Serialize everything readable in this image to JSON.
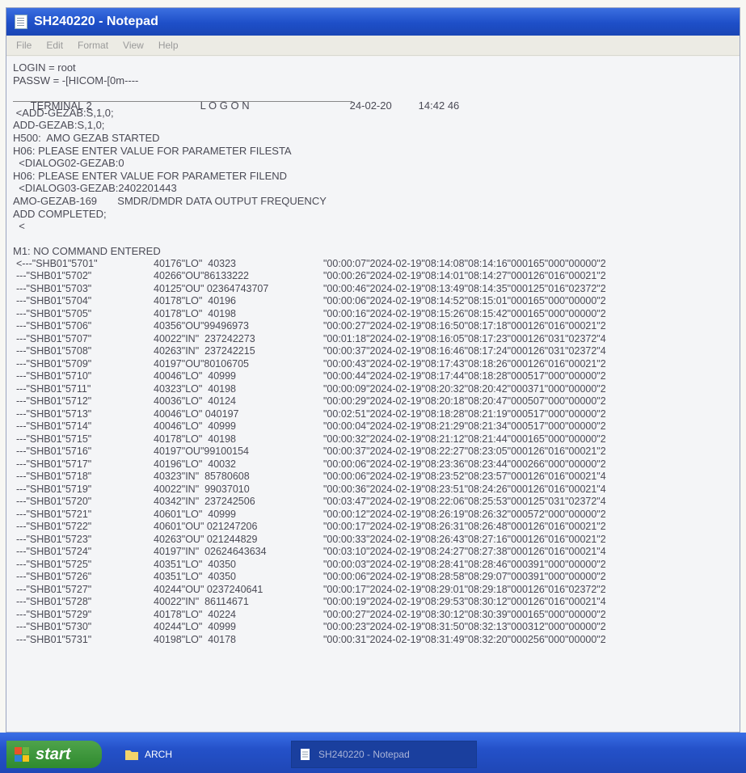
{
  "window": {
    "title": "SH240220 - Notepad"
  },
  "menu": [
    "File",
    "Edit",
    "Format",
    "View",
    "Help"
  ],
  "header": {
    "login": "LOGIN = root",
    "passw": "PASSW = -[HICOM-[0m----",
    "terminal": "TERMINAL 2",
    "logon": "L O G O N",
    "date": "24-02-20",
    "time": "14:42 46"
  },
  "log_lines": [
    " <ADD-GEZAB:S,1,0;",
    "ADD-GEZAB:S,1,0;",
    "H500:  AMO GEZAB STARTED",
    "H06: PLEASE ENTER VALUE FOR PARAMETER FILESTA",
    "  <DIALOG02-GEZAB:0",
    "H06: PLEASE ENTER VALUE FOR PARAMETER FILEND",
    "  <DIALOG03-GEZAB:2402201443",
    "AMO-GEZAB-169       SMDR/DMDR DATA OUTPUT FREQUENCY",
    "ADD COMPLETED;",
    "  <",
    "",
    "M1: NO COMMAND ENTERED"
  ],
  "records": [
    [
      "<---\"SHB01\"5701\"",
      "40176\"LO\"  40323",
      "\"00:00:07\"2024-02-19\"08:14:08\"08:14:16\"000165\"000\"00000\"2"
    ],
    [
      "---\"SHB01\"5702\"",
      "40266\"OU\"86133222",
      "\"00:00:26\"2024-02-19\"08:14:01\"08:14:27\"000126\"016\"00021\"2"
    ],
    [
      "---\"SHB01\"5703\"",
      "40125\"OU\" 02364743707",
      "\"00:00:46\"2024-02-19\"08:13:49\"08:14:35\"000125\"016\"02372\"2"
    ],
    [
      "---\"SHB01\"5704\"",
      "40178\"LO\"  40196",
      "\"00:00:06\"2024-02-19\"08:14:52\"08:15:01\"000165\"000\"00000\"2"
    ],
    [
      "---\"SHB01\"5705\"",
      "40178\"LO\"  40198",
      "\"00:00:16\"2024-02-19\"08:15:26\"08:15:42\"000165\"000\"00000\"2"
    ],
    [
      "---\"SHB01\"5706\"",
      "40356\"OU\"99496973",
      "\"00:00:27\"2024-02-19\"08:16:50\"08:17:18\"000126\"016\"00021\"2"
    ],
    [
      "---\"SHB01\"5707\"",
      "40022\"IN\"  237242273",
      "\"00:01:18\"2024-02-19\"08:16:05\"08:17:23\"000126\"031\"02372\"4"
    ],
    [
      "---\"SHB01\"5708\"",
      "40263\"IN\"  237242215",
      "\"00:00:37\"2024-02-19\"08:16:46\"08:17:24\"000126\"031\"02372\"4"
    ],
    [
      "---\"SHB01\"5709\"",
      "40197\"OU\"80106705",
      "\"00:00:43\"2024-02-19\"08:17:43\"08:18:26\"000126\"016\"00021\"2"
    ],
    [
      "---\"SHB01\"5710\"",
      "40046\"LO\"  40999",
      "\"00:00:44\"2024-02-19\"08:17:44\"08:18:28\"000517\"000\"00000\"2"
    ],
    [
      "---\"SHB01\"5711\"",
      "40323\"LO\"  40198",
      "\"00:00:09\"2024-02-19\"08:20:32\"08:20:42\"000371\"000\"00000\"2"
    ],
    [
      "---\"SHB01\"5712\"",
      "40036\"LO\"  40124",
      "\"00:00:29\"2024-02-19\"08:20:18\"08:20:47\"000507\"000\"00000\"2"
    ],
    [
      "---\"SHB01\"5713\"",
      "40046\"LO\" 040197",
      "\"00:02:51\"2024-02-19\"08:18:28\"08:21:19\"000517\"000\"00000\"2"
    ],
    [
      "---\"SHB01\"5714\"",
      "40046\"LO\"  40999",
      "\"00:00:04\"2024-02-19\"08:21:29\"08:21:34\"000517\"000\"00000\"2"
    ],
    [
      "---\"SHB01\"5715\"",
      "40178\"LO\"  40198",
      "\"00:00:32\"2024-02-19\"08:21:12\"08:21:44\"000165\"000\"00000\"2"
    ],
    [
      "---\"SHB01\"5716\"",
      "40197\"OU\"99100154",
      "\"00:00:37\"2024-02-19\"08:22:27\"08:23:05\"000126\"016\"00021\"2"
    ],
    [
      "---\"SHB01\"5717\"",
      "40196\"LO\"  40032",
      "\"00:00:06\"2024-02-19\"08:23:36\"08:23:44\"000266\"000\"00000\"2"
    ],
    [
      "---\"SHB01\"5718\"",
      "40323\"IN\"  85780608",
      "\"00:00:06\"2024-02-19\"08:23:52\"08:23:57\"000126\"016\"00021\"4"
    ],
    [
      "---\"SHB01\"5719\"",
      "40022\"IN\"  99037010",
      "\"00:00:36\"2024-02-19\"08:23:51\"08:24:26\"000126\"016\"00021\"4"
    ],
    [
      "---\"SHB01\"5720\"",
      "40342\"IN\"  237242506",
      "\"00:03:47\"2024-02-19\"08:22:06\"08:25:53\"000125\"031\"02372\"4"
    ],
    [
      "---\"SHB01\"5721\"",
      "40601\"LO\"  40999",
      "\"00:00:12\"2024-02-19\"08:26:19\"08:26:32\"000572\"000\"00000\"2"
    ],
    [
      "---\"SHB01\"5722\"",
      "40601\"OU\" 021247206",
      "\"00:00:17\"2024-02-19\"08:26:31\"08:26:48\"000126\"016\"00021\"2"
    ],
    [
      "---\"SHB01\"5723\"",
      "40263\"OU\" 021244829",
      "\"00:00:33\"2024-02-19\"08:26:43\"08:27:16\"000126\"016\"00021\"2"
    ],
    [
      "---\"SHB01\"5724\"",
      "40197\"IN\"  02624643634",
      "\"00:03:10\"2024-02-19\"08:24:27\"08:27:38\"000126\"016\"00021\"4"
    ],
    [
      "---\"SHB01\"5725\"",
      "40351\"LO\"  40350",
      "\"00:00:03\"2024-02-19\"08:28:41\"08:28:46\"000391\"000\"00000\"2"
    ],
    [
      "---\"SHB01\"5726\"",
      "40351\"LO\"  40350",
      "\"00:00:06\"2024-02-19\"08:28:58\"08:29:07\"000391\"000\"00000\"2"
    ],
    [
      "---\"SHB01\"5727\"",
      "40244\"OU\" 0237240641",
      "\"00:00:17\"2024-02-19\"08:29:01\"08:29:18\"000126\"016\"02372\"2"
    ],
    [
      "---\"SHB01\"5728\"",
      "40022\"IN\"  86114671",
      "\"00:00:19\"2024-02-19\"08:29:53\"08:30:12\"000126\"016\"00021\"4"
    ],
    [
      "---\"SHB01\"5729\"",
      "40178\"LO\"  40224",
      "\"00:00:27\"2024-02-19\"08:30:12\"08:30:39\"000165\"000\"00000\"2"
    ],
    [
      "---\"SHB01\"5730\"",
      "40244\"LO\"  40999",
      "\"00:00:23\"2024-02-19\"08:31:50\"08:32:13\"000312\"000\"00000\"2"
    ],
    [
      "---\"SHB01\"5731\"",
      "40198\"LO\"  40178",
      "\"00:00:31\"2024-02-19\"08:31:49\"08:32:20\"000256\"000\"00000\"2"
    ]
  ],
  "taskbar": {
    "start_label": "start",
    "items": [
      "ARCH",
      "SH240220 - Notepad"
    ]
  },
  "colors": {
    "title_bar": "#1e4fc8",
    "taskbar": "#2451c9",
    "start_button": "#2f8a2e"
  }
}
